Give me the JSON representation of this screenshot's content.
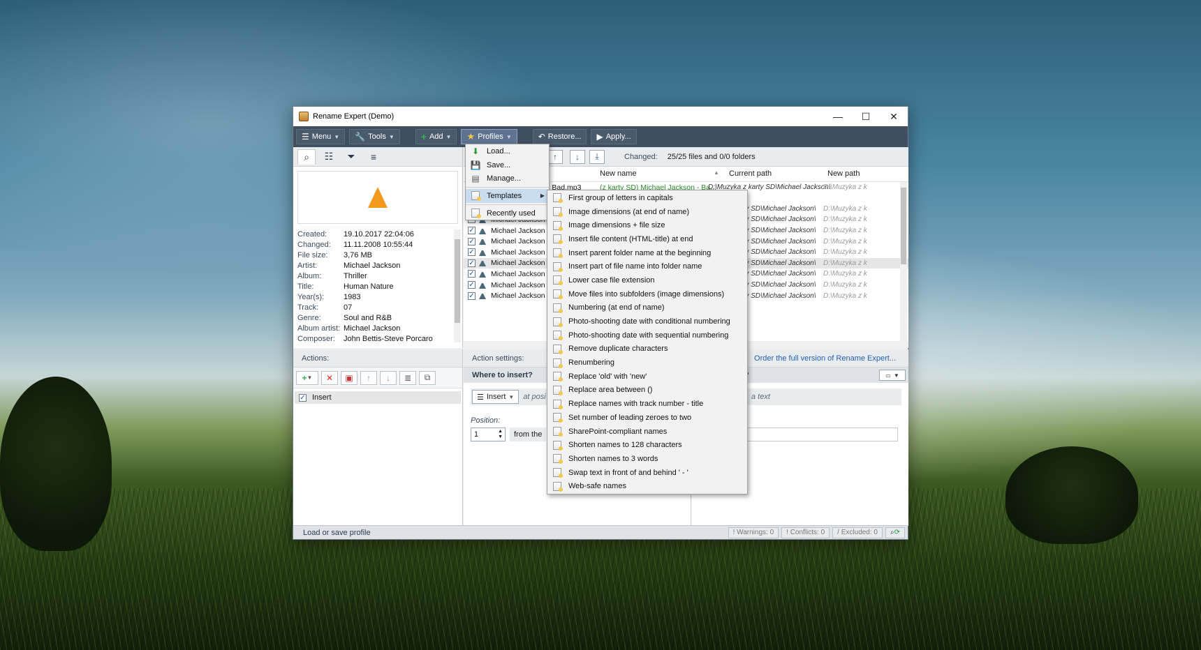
{
  "window": {
    "title": "Rename Expert (Demo)"
  },
  "toolbar": {
    "menu": "Menu",
    "tools": "Tools",
    "add": "Add",
    "profiles": "Profiles",
    "restore": "Restore...",
    "apply": "Apply..."
  },
  "profiles_menu": {
    "load": "Load...",
    "save": "Save...",
    "manage": "Manage...",
    "templates": "Templates",
    "recent": "Recently used"
  },
  "templates": [
    "First group of letters in capitals",
    "Image dimensions (at end of name)",
    "Image dimensions + file size",
    "Insert file content (HTML-title)  at end",
    "Insert parent folder name at the beginning",
    "Insert part of file name into folder name",
    "Lower case file extension",
    "Move files into subfolders (image dimensions)",
    "Numbering (at end of name)",
    "Photo-shooting date with conditional numbering",
    "Photo-shooting date with sequential numbering",
    "Remove duplicate characters",
    "Renumbering",
    "Replace 'old' with 'new'",
    "Replace area between ()",
    "Replace names with track number - title",
    "Set number of leading zeroes to two",
    "SharePoint-compliant names",
    "Shorten names to 128 characters",
    "Shorten names to 3 words",
    "Swap text in front of and behind ' - '",
    "Web-safe names"
  ],
  "metadata": [
    {
      "k": "Created:",
      "v": "19.10.2017 22:04:06"
    },
    {
      "k": "Changed:",
      "v": "11.11.2008 10:55:44"
    },
    {
      "k": "File size:",
      "v": "3,76 MB"
    },
    {
      "k": "Artist:",
      "v": "Michael Jackson"
    },
    {
      "k": "Album:",
      "v": "Thriller"
    },
    {
      "k": "Title:",
      "v": "Human Nature"
    },
    {
      "k": "Year(s):",
      "v": "1983"
    },
    {
      "k": "Track:",
      "v": "07"
    },
    {
      "k": "Genre:",
      "v": "Soul and R&B"
    },
    {
      "k": "Album artist:",
      "v": "Michael Jackson"
    },
    {
      "k": "Composer:",
      "v": "John Bettis-Steve Porcaro"
    }
  ],
  "file_list": {
    "changed_label": "Changed:",
    "changed_value": "25/25 files and 0/0 folders",
    "columns": {
      "new_name": "New name",
      "current_path": "Current path",
      "new_path": "New path"
    },
    "first_row": {
      "name": "- Bad.mp3",
      "new": "(z karty SD) Michael Jackson - Ba...",
      "cur": "D:\\Muzyka z karty SD\\Michael Jackson\\",
      "np": "D:\\Muzyka z k"
    },
    "rows": [
      {
        "name": "Michael Jackson",
        "cur": "uzyka z karty SD\\Michael Jackson\\",
        "np": "D:\\Muzyka z k"
      },
      {
        "name": "Michael Jackson",
        "cur": "uzyka z karty SD\\Michael Jackson\\",
        "np": "D:\\Muzyka z k"
      },
      {
        "name": "Michael Jackson",
        "cur": "uzyka z karty SD\\Michael Jackson\\",
        "np": "D:\\Muzyka z k"
      },
      {
        "name": "Michael Jackson",
        "cur": "uzyka z karty SD\\Michael Jackson\\",
        "np": "D:\\Muzyka z k"
      },
      {
        "name": "Michael Jackson",
        "cur": "uzyka z karty SD\\Michael Jackson\\",
        "np": "D:\\Muzyka z k"
      },
      {
        "name": "Michael Jackson",
        "cur": "uzyka z karty SD\\Michael Jackson\\",
        "np": "D:\\Muzyka z k"
      },
      {
        "name": "Michael Jackson",
        "cur": "uzyka z karty SD\\Michael Jackson\\",
        "np": "D:\\Muzyka z k"
      },
      {
        "name": "Michael Jackson",
        "cur": "uzyka z karty SD\\Michael Jackson\\",
        "np": "D:\\Muzyka z k"
      },
      {
        "name": "Michael Jackson",
        "cur": "uzyka z karty SD\\Michael Jackson\\",
        "np": "D:\\Muzyka z k"
      }
    ]
  },
  "actions": {
    "header": "Actions:",
    "item": "Insert"
  },
  "settings": {
    "header": "Action settings:",
    "order_link": "Order the full version of Rename Expert...",
    "where": "Where to insert?",
    "insert_btn": "Insert",
    "at_pos": "at posi",
    "a_text": "a text",
    "position_label": "Position:",
    "position_value": "1",
    "from_the": "from the"
  },
  "status": {
    "text": "Load or save profile",
    "warnings": "Warnings: 0",
    "conflicts": "Conflicts: 0",
    "excluded": "Excluded: 0"
  }
}
